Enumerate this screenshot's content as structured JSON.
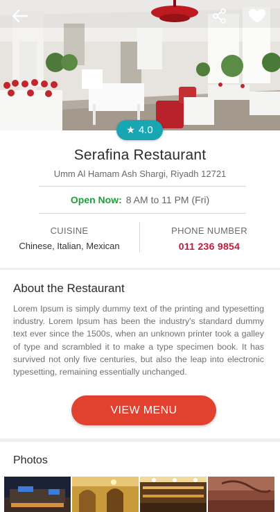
{
  "hero": {
    "back_icon": "arrow-left-icon",
    "share_icon": "share-icon",
    "favorite_icon": "heart-icon"
  },
  "rating": {
    "value": "4.0",
    "icon": "star-icon",
    "color": "#18a6b3"
  },
  "restaurant": {
    "name": "Serafina Restaurant",
    "address": "Umm Al Hamam Ash Shargi, Riyadh 12721",
    "hours_label": "Open Now:",
    "hours_value": "8 AM to 11 PM (Fri)",
    "cuisine_label": "CUISINE",
    "cuisine_value": "Chinese, Italian, Mexican",
    "phone_label": "PHONE NUMBER",
    "phone_value": "011 236 9854"
  },
  "about": {
    "title": "About the Restaurant",
    "text": "Lorem Ipsum is simply dummy text of the printing and typesetting industry. Lorem Ipsum has been the industry's standard dummy text ever since the 1500s, when an unknown printer took a galley of type and scrambled it to make a type specimen book. It has survived not only five centuries, but also the leap into electronic typesetting, remaining essentially unchanged.",
    "button_label": "VIEW MENU"
  },
  "photos": {
    "title": "Photos"
  },
  "colors": {
    "accent": "#e2412f",
    "open_green": "#1f9e3a",
    "phone_red": "#c2183b",
    "rating_teal": "#18a6b3"
  }
}
